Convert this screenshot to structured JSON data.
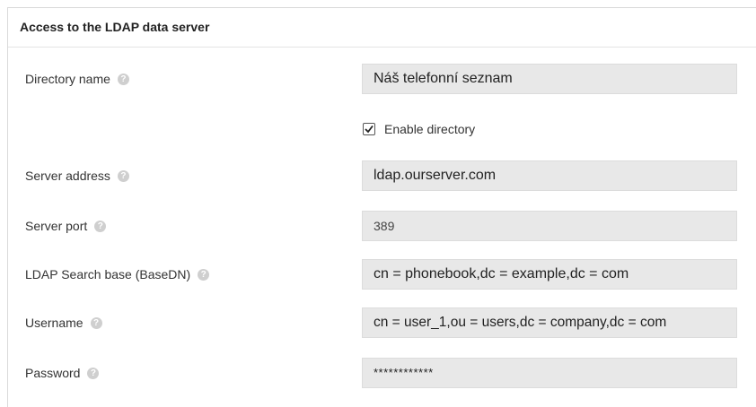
{
  "section": {
    "title": "Access to the LDAP data server"
  },
  "fields": {
    "directory_name": {
      "label": "Directory name",
      "value": "Náš telefonní seznam"
    },
    "enable_directory": {
      "label": "Enable directory",
      "checked": true
    },
    "server_address": {
      "label": "Server address",
      "value": "ldap.ourserver.com"
    },
    "server_port": {
      "label": "Server port",
      "value": "389"
    },
    "search_base": {
      "label": "LDAP Search base (BaseDN)",
      "value": "cn = phonebook,dc = example,dc = com"
    },
    "username": {
      "label": "Username",
      "value": "cn = user_1,ou = users,dc = company,dc = com"
    },
    "password": {
      "label": "Password",
      "value": "************"
    }
  },
  "help_icon": "help-icon",
  "colors": {
    "field_bg": "#e8e8e8",
    "help_icon": "#cfcfcf"
  }
}
